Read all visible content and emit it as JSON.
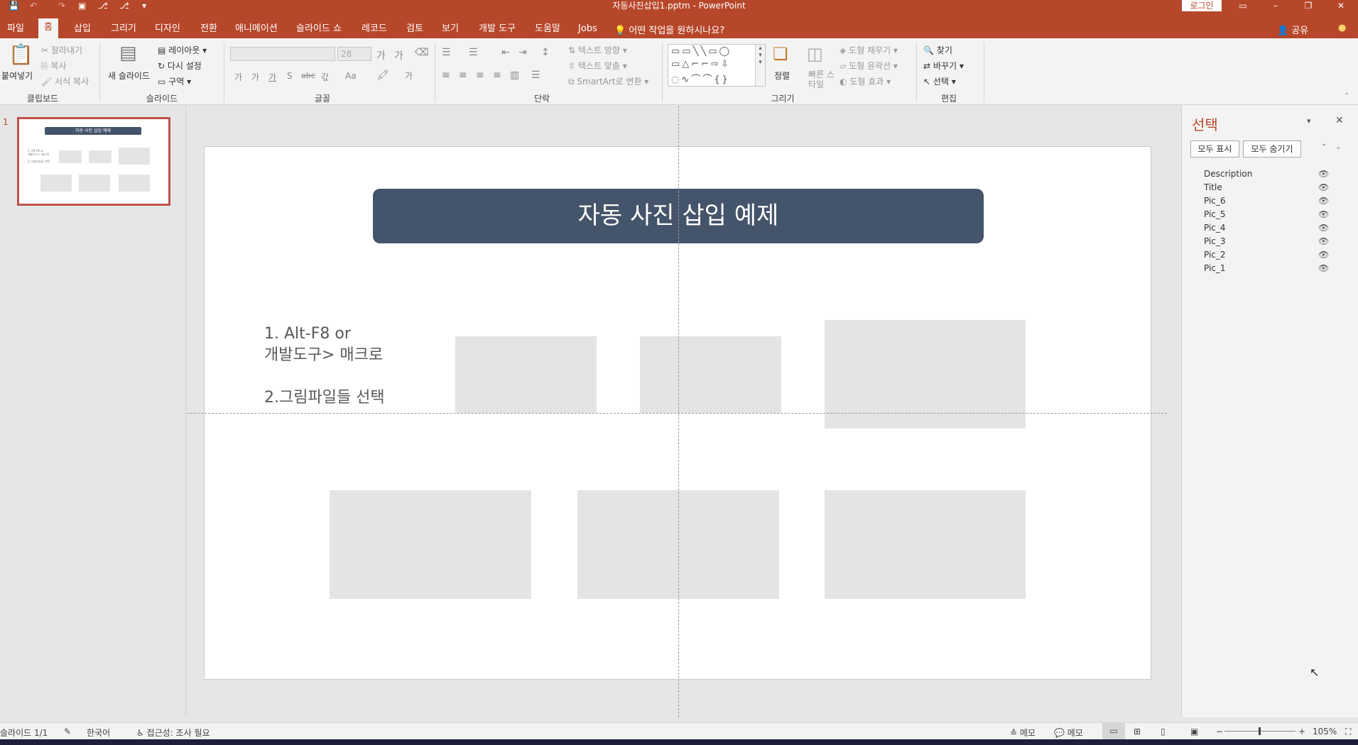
{
  "window": {
    "title": "자동사진삽입1.pptm  -  PowerPoint",
    "login": "로그인"
  },
  "tabs": [
    "파일",
    "홈",
    "삽입",
    "그리기",
    "디자인",
    "전환",
    "애니메이션",
    "슬라이드 쇼",
    "레코드",
    "검토",
    "보기",
    "개발 도구",
    "도움말",
    "Jobs"
  ],
  "tell_me": "어떤 작업을 원하시나요?",
  "share": "공유",
  "ribbon": {
    "clipboard": {
      "label": "클립보드",
      "paste": "붙여넣기",
      "cut": "잘라내기",
      "copy": "복사",
      "format_painter": "서식 복사"
    },
    "slides": {
      "label": "슬라이드",
      "new_slide": "새 슬라이드",
      "layout": "레이아웃",
      "reset": "다시 설정",
      "section": "구역"
    },
    "font": {
      "label": "글꼴",
      "size": "28"
    },
    "paragraph": {
      "label": "단락",
      "text_direction": "텍스트 방향",
      "align_text": "텍스트 맞춤",
      "smartart": "SmartArt로 변환"
    },
    "drawing": {
      "label": "그리기",
      "arrange": "정렬",
      "quick_styles": "빠른 스타일",
      "shape_fill": "도형 채우기",
      "shape_outline": "도형 윤곽선",
      "shape_effects": "도형 효과"
    },
    "editing": {
      "label": "편집",
      "find": "찾기",
      "replace": "바꾸기",
      "select": "선택"
    }
  },
  "thumbnail": {
    "number": "1",
    "title": "자동 사진 삽입 예제",
    "desc": "1. Alt-F8 or\n개발도구> 매크로\n\n2.그림파일들 선택"
  },
  "slide": {
    "title": "자동 사진 삽입 예제",
    "description": "1. Alt-F8 or\n개발도구> 매크로\n\n2.그림파일들 선택"
  },
  "selection_pane": {
    "title": "선택",
    "show_all": "모두 표시",
    "hide_all": "모두 숨기기",
    "items": [
      "Description",
      "Title",
      "Pic_6",
      "Pic_5",
      "Pic_4",
      "Pic_3",
      "Pic_2",
      "Pic_1"
    ]
  },
  "status": {
    "slide": "슬라이드 1/1",
    "language": "한국어",
    "accessibility": "접근성: 조사 필요",
    "notes": "메모",
    "comments": "메모",
    "zoom": "105%"
  },
  "colors": {
    "accent": "#b7472a",
    "title_fill": "#44546a",
    "placeholder": "#e4e4e4"
  }
}
